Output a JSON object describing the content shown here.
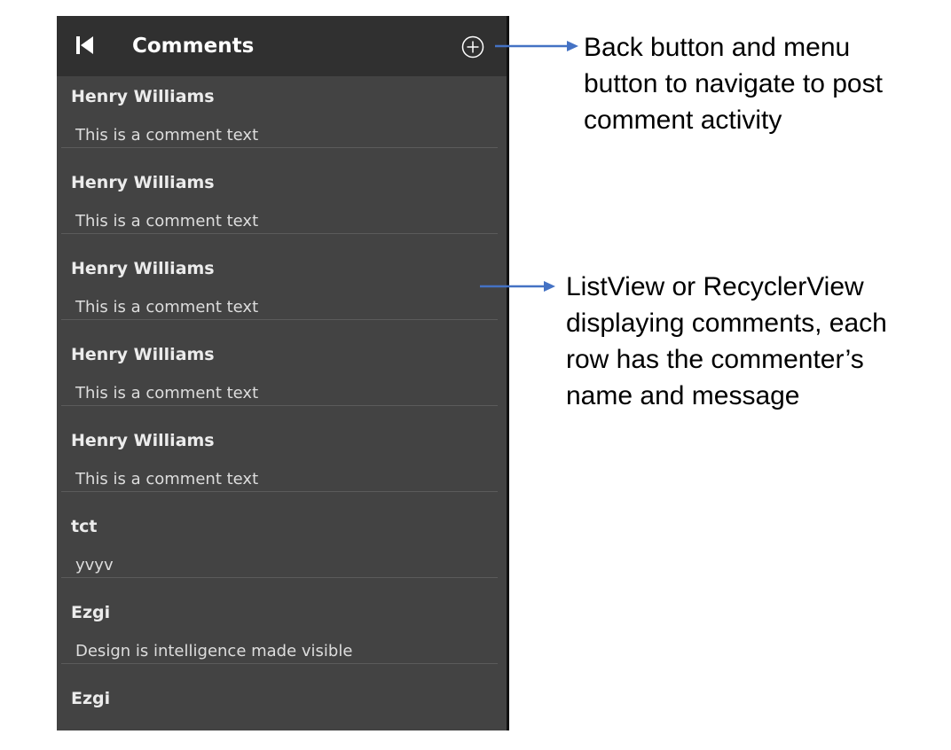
{
  "app": {
    "title": "Comments",
    "back_icon": "skip-back-icon",
    "add_icon": "plus-circle-icon"
  },
  "comments": [
    {
      "author": "Henry Williams",
      "message": "This is a comment text"
    },
    {
      "author": "Henry Williams",
      "message": "This is a comment text"
    },
    {
      "author": "Henry Williams",
      "message": "This is a comment text"
    },
    {
      "author": "Henry Williams",
      "message": "This is a comment text"
    },
    {
      "author": "Henry Williams",
      "message": "This is a comment text"
    },
    {
      "author": "tct",
      "message": "yvyv"
    },
    {
      "author": "Ezgi",
      "message": "Design is intelligence made visible"
    },
    {
      "author": "Ezgi",
      "message": ""
    }
  ],
  "annotations": {
    "toolbar": [
      "Back button and menu",
      "button to navigate to post",
      "comment activity"
    ],
    "list": [
      "ListView or RecyclerView",
      "displaying comments, each",
      "row has the commenter’s",
      "name and message"
    ]
  },
  "colors": {
    "appbar": "#303030",
    "list_background": "#434343",
    "arrow": "#4472c4"
  }
}
